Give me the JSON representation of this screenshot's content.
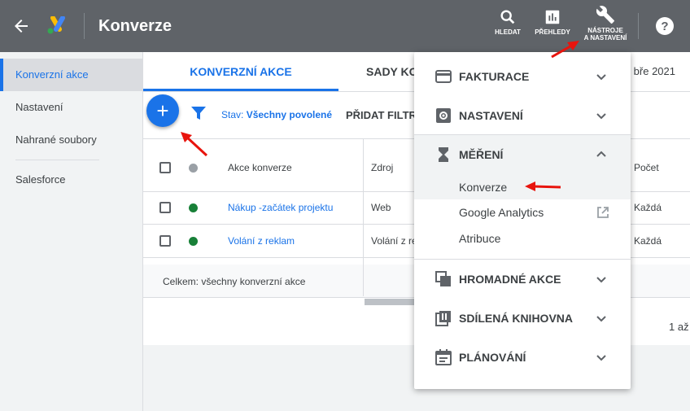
{
  "header": {
    "title": "Konverze",
    "buttons": [
      {
        "label": "HLEDAT"
      },
      {
        "label": "PŘEHLEDY"
      },
      {
        "label_line1": "NÁSTROJE",
        "label_line2": "A NASTAVENÍ"
      }
    ]
  },
  "sidebar": {
    "items": [
      {
        "label": "Konverzní akce"
      },
      {
        "label": "Nastavení"
      },
      {
        "label": "Nahrané soubory"
      },
      {
        "label": "Salesforce"
      }
    ]
  },
  "tabs": [
    {
      "label": "KONVERZNÍ AKCE"
    },
    {
      "label": "SADY KO"
    }
  ],
  "date_fragment": "bře 2021",
  "filter": {
    "prefix": "Stav: ",
    "value": "Všechny povolené",
    "add_label": "PŘIDAT FILTR"
  },
  "table": {
    "headers": {
      "action": "Akce konverze",
      "source": "Zdroj",
      "count": "Počet"
    },
    "rows": [
      {
        "name": "Nákup -začátek projektu",
        "source": "Web",
        "count": "Každá",
        "status": "#188038"
      },
      {
        "name": "Volání z reklam",
        "source": "Volání z re",
        "count": "Každá",
        "status": "#188038"
      }
    ],
    "total_label": "Celkem: všechny konverzní akce"
  },
  "pager": "1 až",
  "menu": {
    "sections": [
      {
        "label": "FAKTURACE",
        "icon": "credit-card-icon"
      },
      {
        "label": "NASTAVENÍ",
        "icon": "settings-icon"
      },
      {
        "label": "MĚŘENÍ",
        "icon": "hourglass-icon",
        "expanded": true,
        "items": [
          {
            "label": "Konverze"
          },
          {
            "label": "Google Analytics"
          },
          {
            "label": "Atribuce"
          }
        ]
      },
      {
        "label": "HROMADNÉ AKCE",
        "icon": "copy-icon"
      },
      {
        "label": "SDÍLENÁ KNIHOVNA",
        "icon": "library-icon"
      },
      {
        "label": "PLÁNOVÁNÍ",
        "icon": "calendar-icon"
      }
    ]
  },
  "colors": {
    "accent": "#1a73e8",
    "topbar": "#5f6368",
    "arrow": "#e8140d"
  }
}
